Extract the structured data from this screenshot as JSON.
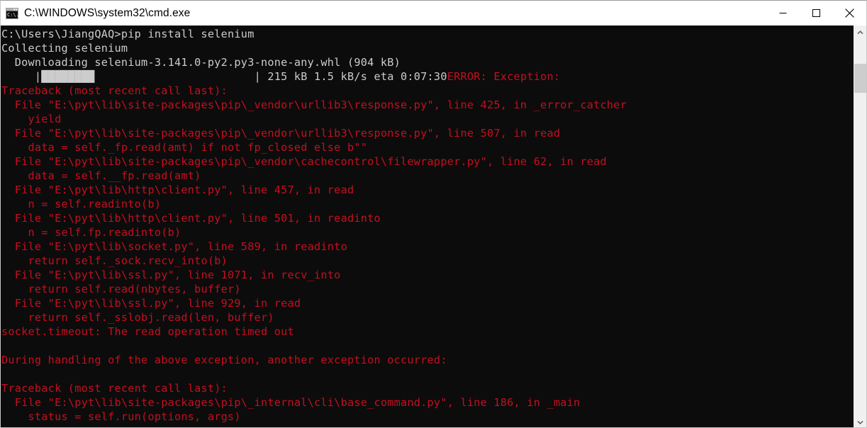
{
  "window": {
    "title": "C:\\WINDOWS\\system32\\cmd.exe",
    "icon": "cmd-console-icon",
    "titlebar_bg": "#ffffff",
    "console_bg": "#0c0c0c"
  },
  "caption": {
    "minimize_label": "Minimize",
    "maximize_label": "Maximize",
    "close_label": "Close",
    "minimize_icon": "minimize-icon",
    "maximize_icon": "maximize-icon",
    "close_icon": "close-icon"
  },
  "scrollbar": {
    "up_icon": "chevron-up-icon",
    "down_icon": "chevron-down-icon",
    "thumb_color": "#cdcdcd",
    "track_color": "#f0f0f0"
  },
  "colors": {
    "text_white": "#cccccc",
    "text_red": "#c50f1f",
    "background": "#0c0c0c"
  },
  "console": {
    "prompt": "C:\\Users\\JiangQAQ>",
    "command": "pip install selenium",
    "package": "selenium",
    "wheel": "selenium-3.141.0-py2.py3-none-any.whl",
    "wheel_size": "904 kB",
    "progress": {
      "downloaded": "215 kB",
      "speed": "1.5 kB/s",
      "eta": "0:07:30",
      "blocks": "████████",
      "left_bracket": "|",
      "right_bracket": "|"
    },
    "lines": [
      [
        {
          "text": "C:\\Users\\JiangQAQ>pip install selenium",
          "color": "white"
        }
      ],
      [
        {
          "text": "Collecting selenium",
          "color": "white"
        }
      ],
      [
        {
          "text": "  Downloading selenium-3.141.0-py2.py3-none-any.whl (904 kB)",
          "color": "white"
        }
      ],
      [
        {
          "text": "     |████████                        | 215 kB 1.5 kB/s eta 0:07:30",
          "color": "white"
        },
        {
          "text": "ERROR: Exception:",
          "color": "red"
        }
      ],
      [
        {
          "text": "Traceback (most recent call last):",
          "color": "red"
        }
      ],
      [
        {
          "text": "  File \"E:\\pyt\\lib\\site-packages\\pip\\_vendor\\urllib3\\response.py\", line 425, in _error_catcher",
          "color": "red"
        }
      ],
      [
        {
          "text": "    yield",
          "color": "red"
        }
      ],
      [
        {
          "text": "  File \"E:\\pyt\\lib\\site-packages\\pip\\_vendor\\urllib3\\response.py\", line 507, in read",
          "color": "red"
        }
      ],
      [
        {
          "text": "    data = self._fp.read(amt) if not fp_closed else b\"\"",
          "color": "red"
        }
      ],
      [
        {
          "text": "  File \"E:\\pyt\\lib\\site-packages\\pip\\_vendor\\cachecontrol\\filewrapper.py\", line 62, in read",
          "color": "red"
        }
      ],
      [
        {
          "text": "    data = self.__fp.read(amt)",
          "color": "red"
        }
      ],
      [
        {
          "text": "  File \"E:\\pyt\\lib\\http\\client.py\", line 457, in read",
          "color": "red"
        }
      ],
      [
        {
          "text": "    n = self.readinto(b)",
          "color": "red"
        }
      ],
      [
        {
          "text": "  File \"E:\\pyt\\lib\\http\\client.py\", line 501, in readinto",
          "color": "red"
        }
      ],
      [
        {
          "text": "    n = self.fp.readinto(b)",
          "color": "red"
        }
      ],
      [
        {
          "text": "  File \"E:\\pyt\\lib\\socket.py\", line 589, in readinto",
          "color": "red"
        }
      ],
      [
        {
          "text": "    return self._sock.recv_into(b)",
          "color": "red"
        }
      ],
      [
        {
          "text": "  File \"E:\\pyt\\lib\\ssl.py\", line 1071, in recv_into",
          "color": "red"
        }
      ],
      [
        {
          "text": "    return self.read(nbytes, buffer)",
          "color": "red"
        }
      ],
      [
        {
          "text": "  File \"E:\\pyt\\lib\\ssl.py\", line 929, in read",
          "color": "red"
        }
      ],
      [
        {
          "text": "    return self._sslobj.read(len, buffer)",
          "color": "red"
        }
      ],
      [
        {
          "text": "socket.timeout: The read operation timed out",
          "color": "red"
        }
      ],
      [
        {
          "text": "",
          "color": "red"
        }
      ],
      [
        {
          "text": "During handling of the above exception, another exception occurred:",
          "color": "red"
        }
      ],
      [
        {
          "text": "",
          "color": "red"
        }
      ],
      [
        {
          "text": "Traceback (most recent call last):",
          "color": "red"
        }
      ],
      [
        {
          "text": "  File \"E:\\pyt\\lib\\site-packages\\pip\\_internal\\cli\\base_command.py\", line 186, in _main",
          "color": "red"
        }
      ],
      [
        {
          "text": "    status = self.run(options, args)",
          "color": "red"
        }
      ]
    ]
  }
}
